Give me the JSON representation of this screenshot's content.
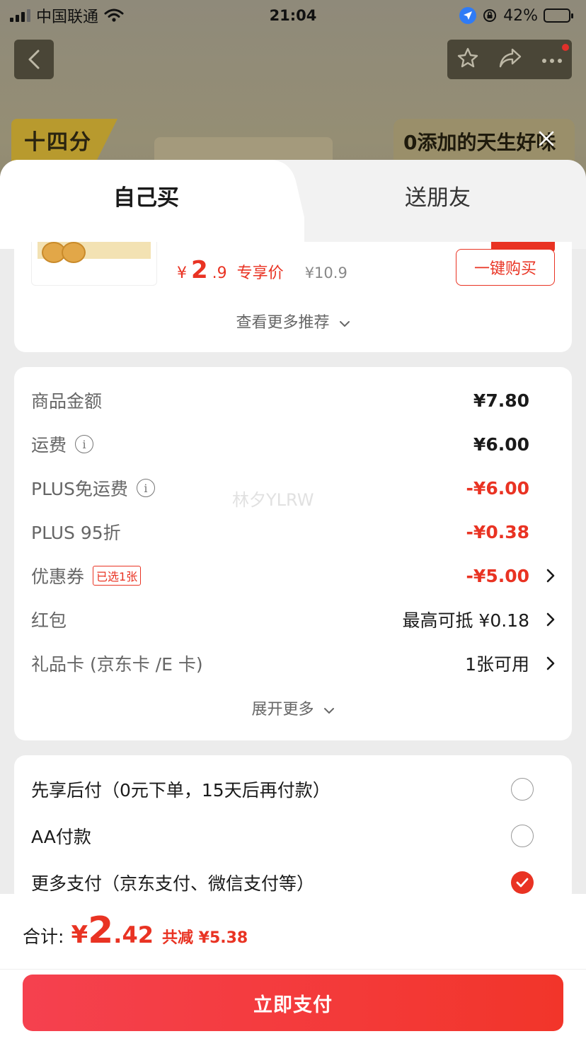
{
  "status_bar": {
    "carrier": "中国联通",
    "time": "21:04",
    "battery": "42%",
    "battery_level": 0.42
  },
  "background": {
    "banner_left": "十四分",
    "banner_right": "0添加的天生好味"
  },
  "tabs": {
    "self_buy": "自己买",
    "gift": "送朋友"
  },
  "recommend": {
    "price_symbol": "¥",
    "price_int": "2",
    "price_dec": ".9",
    "price_tag": "专享价",
    "original_price": "¥10.9",
    "buy_button": "一键购买",
    "more_label": "查看更多推荐"
  },
  "fees": {
    "watermark": "林夕YLRW",
    "rows": [
      {
        "label": "商品金额",
        "value": "¥7.80"
      },
      {
        "label": "运费",
        "value": "¥6.00"
      },
      {
        "label": "PLUS免运费",
        "value": "-¥6.00"
      },
      {
        "label": "PLUS 95折",
        "value": "-¥0.38"
      },
      {
        "label": "优惠券",
        "tag": "已选1张",
        "value": "-¥5.00"
      },
      {
        "label": "红包",
        "value": "最高可抵 ¥0.18"
      },
      {
        "label": "礼品卡 (京东卡 /E 卡)",
        "value": "1张可用"
      }
    ],
    "expand_label": "展开更多"
  },
  "payment": {
    "options": [
      {
        "label": "先享后付（0元下单，15天后再付款）",
        "selected": false
      },
      {
        "label": "AA付款",
        "selected": false
      },
      {
        "label": "更多支付（京东支付、微信支付等）",
        "selected": true
      }
    ]
  },
  "footer": {
    "total_label": "合计:",
    "total_yen": "¥",
    "total_int": "2",
    "total_dec": ".42",
    "saved": "共减 ¥5.38",
    "pay_button": "立即支付"
  },
  "colors": {
    "accent": "#e93323",
    "pay_button": "#f23a32"
  }
}
